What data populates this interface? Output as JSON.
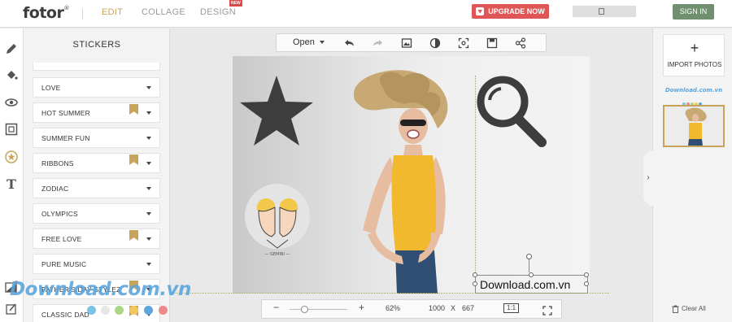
{
  "header": {
    "logo": "fotor",
    "logo_mark": "®",
    "tabs": [
      {
        "label": "EDIT",
        "active": true
      },
      {
        "label": "COLLAGE",
        "active": false
      },
      {
        "label": "DESIGN",
        "active": false
      }
    ],
    "new_badge": "NEW",
    "upgrade_label": "UPGRADE NOW",
    "signin_label": "SIGN IN",
    "colors": {
      "accent": "#c8a45b",
      "upgrade": "#e05656",
      "signin": "#6f8f6f"
    }
  },
  "left_tools": [
    {
      "icon": "pencil-icon"
    },
    {
      "icon": "paint-bucket-icon"
    },
    {
      "icon": "eye-icon"
    },
    {
      "icon": "frame-icon"
    },
    {
      "icon": "sticker-icon",
      "active": true
    },
    {
      "icon": "text-icon"
    },
    {
      "icon": "background-icon"
    },
    {
      "icon": "edit-icon"
    }
  ],
  "stickers": {
    "title": "STICKERS",
    "categories": [
      {
        "label": "LOVE",
        "premium": false
      },
      {
        "label": "HOT SUMMER",
        "premium": true
      },
      {
        "label": "SUMMER FUN",
        "premium": false
      },
      {
        "label": "RIBBONS",
        "premium": true
      },
      {
        "label": "ZODIAC",
        "premium": false
      },
      {
        "label": "OLYMPICS",
        "premium": false
      },
      {
        "label": "FREE LOVE",
        "premium": true
      },
      {
        "label": "PURE MUSIC",
        "premium": false
      },
      {
        "label": "FATHER'S DAY STYLEZ",
        "premium": true
      },
      {
        "label": "CLASSIC DAD",
        "premium": true
      }
    ]
  },
  "toolbar": {
    "open_label": "Open",
    "icons": [
      "undo-icon",
      "redo-icon",
      "image-icon",
      "compare-icon",
      "fit-icon",
      "save-icon",
      "share-icon"
    ]
  },
  "canvas": {
    "sticker_gemini_label": "— GEMINI —",
    "text_box": "Download.com.vn"
  },
  "bottombar": {
    "minus": "−",
    "plus": "+",
    "zoom": "62%",
    "width": "1000",
    "times": "X",
    "height": "667",
    "ratio_label": "1:1"
  },
  "rightbar": {
    "import_plus": "+",
    "import_label": "IMPORT PHOTOS",
    "clear_label": "Clear All",
    "watermark_small": "Download.com.vn"
  },
  "watermark": {
    "text": "Download.com.vn",
    "dot_colors": [
      "#7cc3e8",
      "#e6e6e6",
      "#a9d884",
      "#f3c95d",
      "#5ba6dc",
      "#f08a8a"
    ]
  }
}
